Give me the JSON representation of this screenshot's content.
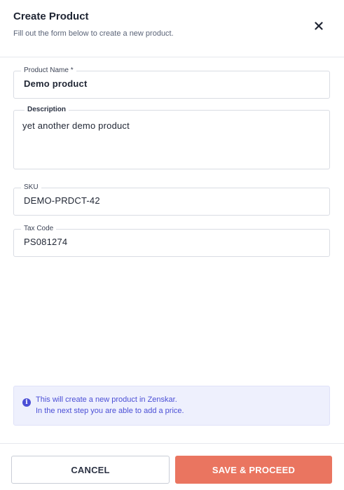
{
  "header": {
    "title": "Create Product",
    "subtitle": "Fill out the form below to create a new product."
  },
  "form": {
    "product_name": {
      "label": "Product Name *",
      "value": "Demo product"
    },
    "description": {
      "label": "Description",
      "value": "yet another demo product"
    },
    "sku": {
      "label": "SKU",
      "value": "DEMO-PRDCT-42"
    },
    "tax_code": {
      "label": "Tax Code",
      "value": "PS081274"
    }
  },
  "info": {
    "icon": "info-icon",
    "line1": "This will create a new product in Zenskar.",
    "line2": "In the next step you are able to add a price."
  },
  "footer": {
    "cancel_label": "CANCEL",
    "save_label": "SAVE & PROCEED"
  },
  "colors": {
    "accent": "#ea7560",
    "info_text": "#4b4fd6",
    "info_bg": "#eef0fd"
  }
}
